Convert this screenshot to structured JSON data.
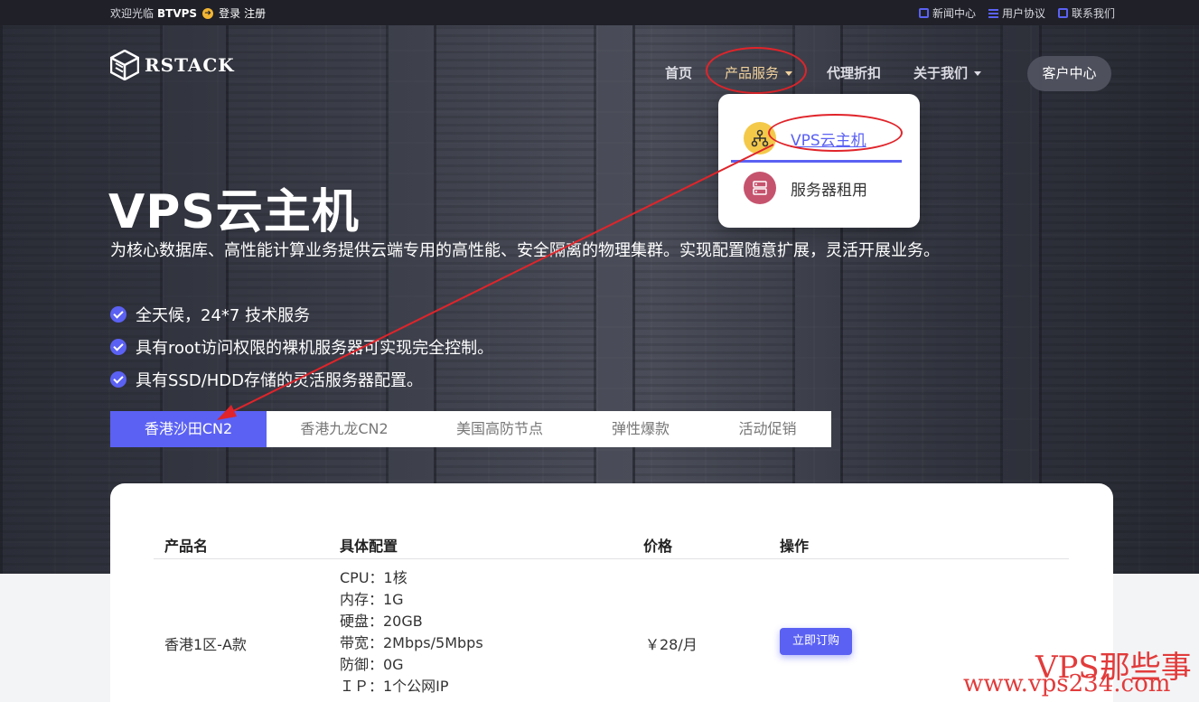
{
  "topbar": {
    "welcome": "欢迎光临",
    "brand": "BTVPS",
    "login": "登录",
    "register": "注册",
    "links": [
      {
        "label": "新闻中心",
        "icon": "square-icon"
      },
      {
        "label": "用户协议",
        "icon": "list-icon"
      },
      {
        "label": "联系我们",
        "icon": "grid-icon"
      }
    ]
  },
  "header": {
    "logo_text": "RSTACK",
    "nav": {
      "home": "首页",
      "products": "产品服务",
      "agent": "代理折扣",
      "about": "关于我们"
    },
    "customer_center": "客户中心"
  },
  "dropdown": {
    "items": [
      {
        "label": "VPS云主机",
        "icon": "cloud-network-icon"
      },
      {
        "label": "服务器租用",
        "icon": "server-icon"
      }
    ]
  },
  "hero": {
    "title": "VPS云主机",
    "subtitle": "为核心数据库、高性能计算业务提供云端专用的高性能、安全隔离的物理集群。实现配置随意扩展，灵活开展业务。",
    "features": [
      "全天候，24*7 技术服务",
      "具有root访问权限的裸机服务器可实现完全控制。",
      "具有SSD/HDD存储的灵活服务器配置。"
    ]
  },
  "tabs": [
    "香港沙田CN2",
    "香港九龙CN2",
    "美国高防节点",
    "弹性爆款",
    "活动促销"
  ],
  "table": {
    "headers": [
      "产品名",
      "具体配置",
      "价格",
      "操作"
    ],
    "rows": [
      {
        "name": "香港1区-A款",
        "specs": [
          "CPU：1核",
          "内存：1G",
          "硬盘：20GB",
          "带宽：2Mbps/5Mbps",
          "防御：0G",
          "ＩＰ：1个公网IP"
        ],
        "price": "￥28/月",
        "action": "立即订购"
      }
    ]
  },
  "watermark": {
    "line1": "VPS那些事",
    "line2": "www.vps234.com"
  },
  "colors": {
    "accent": "#5b61f3",
    "annotation": "#e0242a",
    "nav_active": "#f2d29c"
  }
}
